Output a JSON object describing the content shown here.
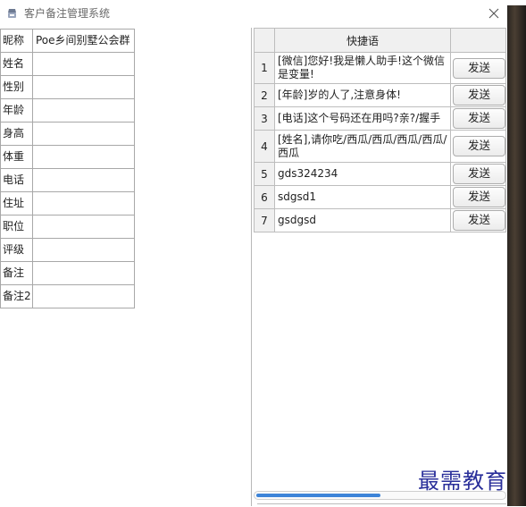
{
  "window": {
    "title": "客户备注管理系统",
    "icon": "app-icon",
    "close_icon": "close-icon"
  },
  "info_table": {
    "rows": [
      {
        "label": "昵称",
        "value": "Poe乡间别墅公会群"
      },
      {
        "label": "姓名",
        "value": ""
      },
      {
        "label": "性别",
        "value": ""
      },
      {
        "label": "年龄",
        "value": ""
      },
      {
        "label": "身高",
        "value": ""
      },
      {
        "label": "体重",
        "value": ""
      },
      {
        "label": "电话",
        "value": ""
      },
      {
        "label": "住址",
        "value": ""
      },
      {
        "label": "职位",
        "value": ""
      },
      {
        "label": "评级",
        "value": ""
      },
      {
        "label": "备注",
        "value": ""
      },
      {
        "label": "备注2",
        "value": ""
      }
    ]
  },
  "phrases": {
    "header": "快捷语",
    "send_label": "发送",
    "rows": [
      {
        "num": "1",
        "text": "[微信]您好!我是懒人助手!这个微信是变量!"
      },
      {
        "num": "2",
        "text": "[年龄]岁的人了,注意身体!"
      },
      {
        "num": "3",
        "text": "[电话]这个号码还在用吗?亲?/握手"
      },
      {
        "num": "4",
        "text": "[姓名],请你吃/西瓜/西瓜/西瓜/西瓜/西瓜"
      },
      {
        "num": "5",
        "text": "gds324234"
      },
      {
        "num": "6",
        "text": "sdgsd1"
      },
      {
        "num": "7",
        "text": "gsdgsd"
      }
    ]
  },
  "scrollbar": {
    "thumb_fraction": 0.5,
    "accent": "#3d84d8"
  },
  "watermark": "最需教育"
}
